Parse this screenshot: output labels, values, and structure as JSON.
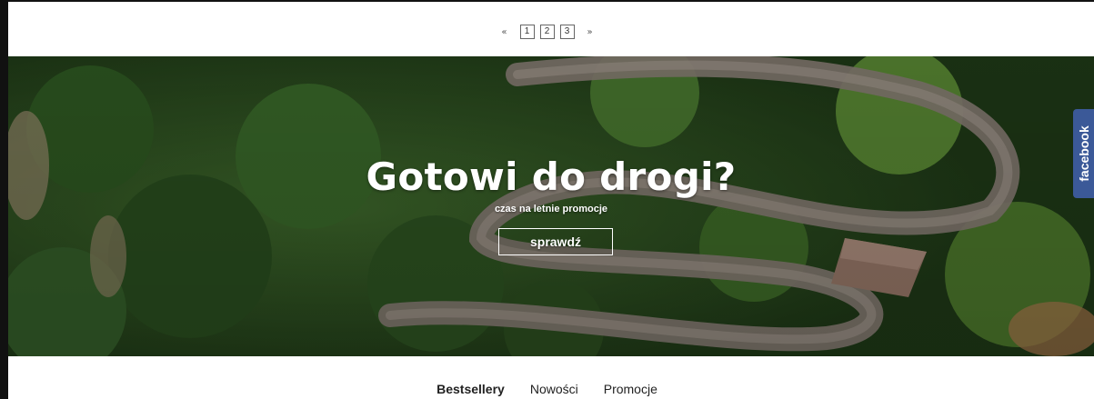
{
  "pagination": {
    "prev": "«",
    "next": "»",
    "pages": [
      "1",
      "2",
      "3"
    ]
  },
  "hero": {
    "title": "Gotowi do drogi?",
    "subtitle": "czas na letnie promocje",
    "button_label": "sprawdź"
  },
  "facebook_tab": {
    "label": "facebook",
    "color": "#3b5998"
  },
  "tabs": [
    {
      "label": "Bestsellery",
      "active": true
    },
    {
      "label": "Nowości",
      "active": false
    },
    {
      "label": "Promocje",
      "active": false
    }
  ]
}
